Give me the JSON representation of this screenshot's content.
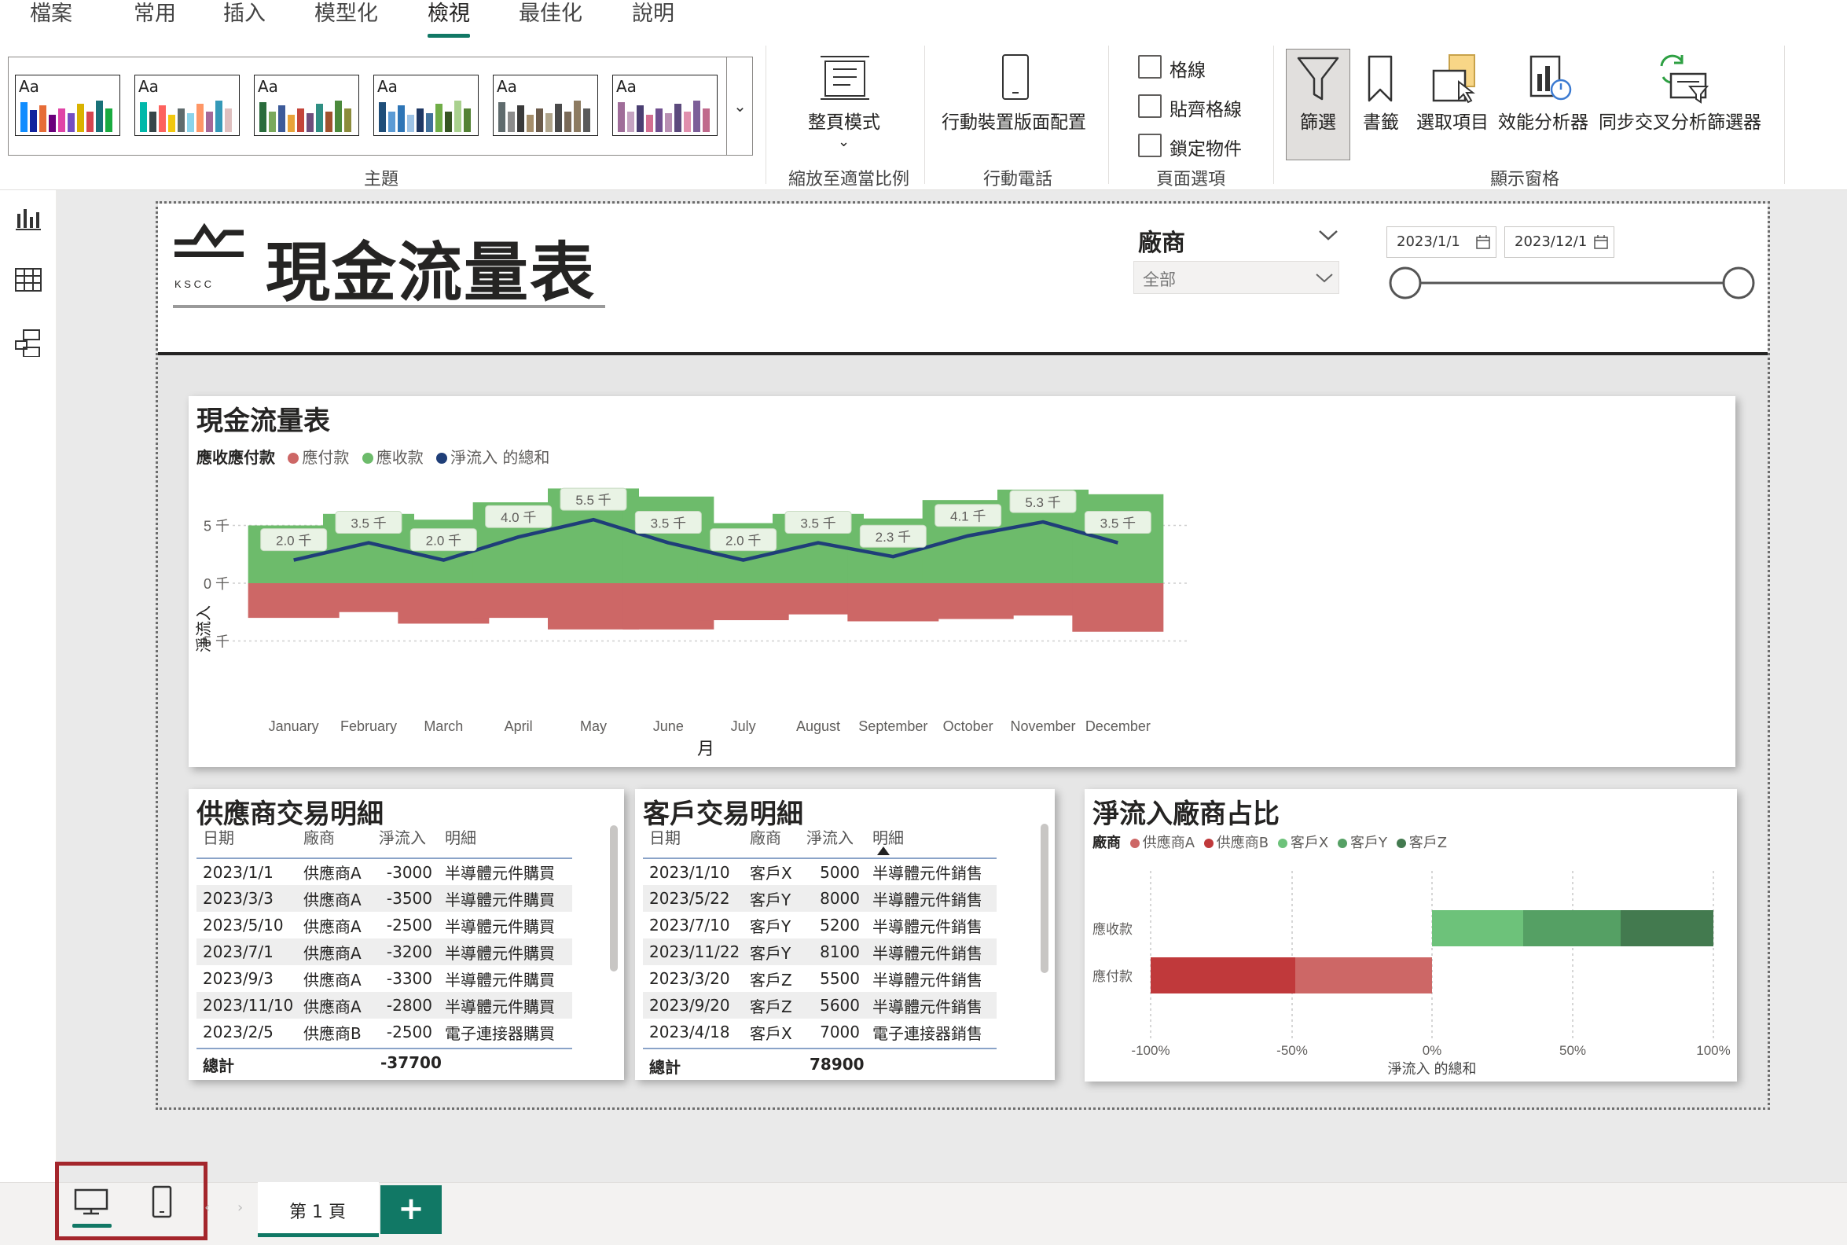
{
  "menu": {
    "tabs": [
      "檔案",
      "常用",
      "插入",
      "模型化",
      "檢視",
      "最佳化",
      "說明"
    ],
    "active_tab": "檢視"
  },
  "ribbon": {
    "groups": {
      "themes": "主題",
      "scale": "縮放至適當比例",
      "mobile": "行動電話",
      "page_options": "頁面選項",
      "show_panes": "顯示窗格"
    },
    "theme_card_label": "Aa",
    "page_view": "整頁模式",
    "mobile_layout": "行動裝置版面配置",
    "checkboxes": {
      "gridlines": "格線",
      "snap_to_grid": "貼齊格線",
      "lock_objects": "鎖定物件"
    },
    "panes": {
      "filters": "篩選",
      "bookmarks": "書籤",
      "selection": "選取項目",
      "performance": "效能分析器",
      "sync_slicers": "同步交叉分析篩選器"
    }
  },
  "report": {
    "title": "現金流量表",
    "logo_text": "K S C C",
    "vendor_slicer": {
      "label": "廠商",
      "value": "全部"
    },
    "date_slicer": {
      "start": "2023/1/1",
      "end": "2023/12/1"
    }
  },
  "chart_data": {
    "type": "bar",
    "title": "現金流量表",
    "legend_title": "應收應付款",
    "legend_position": "top-left",
    "xlabel": "月",
    "ylabel": "淨流入",
    "categories": [
      "January",
      "February",
      "March",
      "April",
      "May",
      "June",
      "July",
      "August",
      "September",
      "October",
      "November",
      "December"
    ],
    "series": [
      {
        "name": "應付款",
        "color": "#cd6766",
        "values": [
          -3.0,
          -2.5,
          -3.5,
          -3.0,
          -4.0,
          -4.0,
          -3.2,
          -2.7,
          -3.3,
          -3.1,
          -2.8,
          -4.2
        ]
      },
      {
        "name": "應收款",
        "color": "#6dbb6b",
        "values": [
          5.0,
          6.0,
          5.5,
          7.0,
          8.2,
          7.5,
          5.2,
          6.0,
          5.6,
          7.2,
          8.1,
          7.7
        ]
      },
      {
        "name": "淨流入 的總和",
        "color": "#1f3e78",
        "values": [
          2.0,
          3.5,
          2.0,
          4.0,
          5.5,
          3.5,
          2.0,
          3.5,
          2.3,
          4.1,
          5.3,
          3.5
        ]
      }
    ],
    "data_labels": [
      "2.0 千",
      "3.5 千",
      "2.0 千",
      "4.0 千",
      "5.5 千",
      "3.5 千",
      "2.0 千",
      "3.5 千",
      "2.3 千",
      "4.1 千",
      "5.3 千",
      "3.5 千"
    ],
    "y_ticks": [
      {
        "v": 5,
        "label": "5 千"
      },
      {
        "v": 0,
        "label": "0 千"
      },
      {
        "v": -5,
        "label": "-5 千"
      }
    ],
    "ylim": [
      -5,
      8.6
    ],
    "grid": true
  },
  "supplier_table": {
    "title": "供應商交易明細",
    "headers": [
      "日期",
      "廠商",
      "淨流入",
      "明細"
    ],
    "rows": [
      [
        "2023/1/1",
        "供應商A",
        "-3000",
        "半導體元件購買"
      ],
      [
        "2023/3/3",
        "供應商A",
        "-3500",
        "半導體元件購買"
      ],
      [
        "2023/5/10",
        "供應商A",
        "-2500",
        "半導體元件購買"
      ],
      [
        "2023/7/1",
        "供應商A",
        "-3200",
        "半導體元件購買"
      ],
      [
        "2023/9/3",
        "供應商A",
        "-3300",
        "半導體元件購買"
      ],
      [
        "2023/11/10",
        "供應商A",
        "-2800",
        "半導體元件購買"
      ],
      [
        "2023/2/5",
        "供應商B",
        "-2500",
        "電子連接器購買"
      ]
    ],
    "total_label": "總計",
    "total_value": "-37700"
  },
  "customer_table": {
    "title": "客戶交易明細",
    "headers": [
      "日期",
      "廠商",
      "淨流入",
      "明細"
    ],
    "rows": [
      [
        "2023/1/10",
        "客戶X",
        "5000",
        "半導體元件銷售"
      ],
      [
        "2023/5/22",
        "客戶Y",
        "8000",
        "半導體元件銷售"
      ],
      [
        "2023/7/10",
        "客戶Y",
        "5200",
        "半導體元件銷售"
      ],
      [
        "2023/11/22",
        "客戶Y",
        "8100",
        "半導體元件銷售"
      ],
      [
        "2023/3/20",
        "客戶Z",
        "5500",
        "半導體元件銷售"
      ],
      [
        "2023/9/20",
        "客戶Z",
        "5600",
        "半導體元件銷售"
      ],
      [
        "2023/4/18",
        "客戶X",
        "7000",
        "電子連接器銷售"
      ]
    ],
    "total_label": "總計",
    "total_value": "78900"
  },
  "share_chart": {
    "title": "淨流入廠商占比",
    "legend_title": "廠商",
    "legend": [
      {
        "name": "供應商A",
        "color": "#cd6766"
      },
      {
        "name": "供應商B",
        "color": "#c0393b"
      },
      {
        "name": "客戶X",
        "color": "#6dc27a"
      },
      {
        "name": "客戶Y",
        "color": "#55a064"
      },
      {
        "name": "客戶Z",
        "color": "#437a4f"
      }
    ],
    "categories": [
      "應收款",
      "應付款"
    ],
    "x_ticks": [
      "-100%",
      "-50%",
      "0%",
      "50%",
      "100%"
    ],
    "xlabel": "淨流入 的總和"
  },
  "bottom": {
    "page_tab": "第 1 頁",
    "add_page": "+"
  }
}
